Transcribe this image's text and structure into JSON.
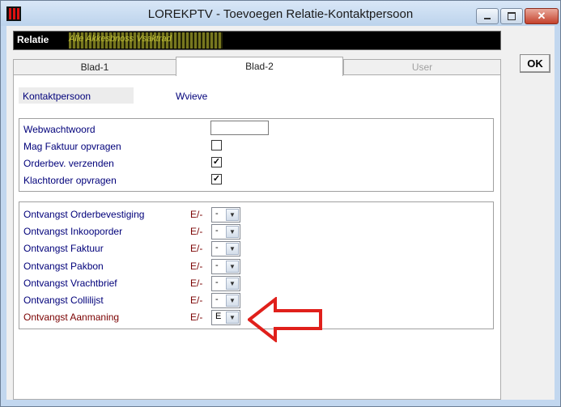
{
  "window": {
    "title": "LOREKPTV - Toevoegen Relatie-Kontaktpersoon"
  },
  "relatie": {
    "label": "Relatie",
    "value": "Alle Akkesbnoss Vsaktrad"
  },
  "ok_label": "OK",
  "tabs": [
    {
      "label": "Blad-1"
    },
    {
      "label": "Blad-2"
    },
    {
      "label": "User"
    }
  ],
  "contact": {
    "label": "Kontaktpersoon",
    "value": "Wvieve"
  },
  "web": {
    "wachtwoord_label": "Webwachtwoord",
    "wachtwoord_value": "",
    "faktuur_label": "Mag Faktuur opvragen",
    "faktuur_checked": false,
    "orderbev_label": "Orderbev. verzenden",
    "orderbev_checked": true,
    "klacht_label": "Klachtorder opvragen",
    "klacht_checked": true
  },
  "ontvangst": [
    {
      "label": "Ontvangst Orderbevestiging",
      "key": "E/-",
      "value": "-",
      "highlight": false
    },
    {
      "label": "Ontvangst Inkooporder",
      "key": "E/-",
      "value": "-",
      "highlight": false
    },
    {
      "label": "Ontvangst Faktuur",
      "key": "E/-",
      "value": "-",
      "highlight": false
    },
    {
      "label": "Ontvangst Pakbon",
      "key": "E/-",
      "value": "-",
      "highlight": false
    },
    {
      "label": "Ontvangst Vrachtbrief",
      "key": "E/-",
      "value": "-",
      "highlight": false
    },
    {
      "label": "Ontvangst Collilijst",
      "key": "E/-",
      "value": "-",
      "highlight": false
    },
    {
      "label": "Ontvangst Aanmaning",
      "key": "E/-",
      "value": "E",
      "highlight": true
    }
  ],
  "colors": {
    "label_blue": "#00007a",
    "label_red": "#7a0000",
    "arrow_red": "#e0201b"
  }
}
